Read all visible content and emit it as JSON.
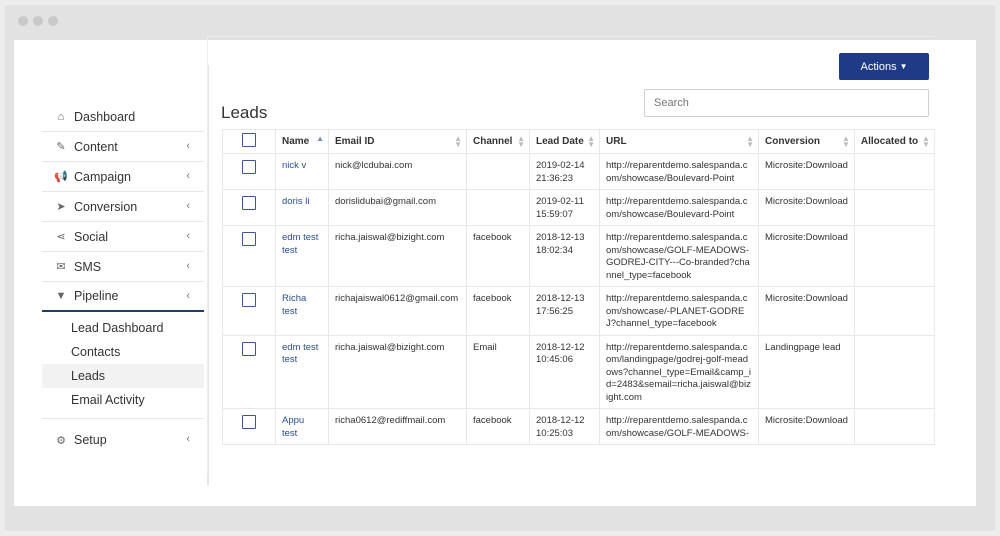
{
  "sidebar": {
    "items": [
      {
        "label": "Dashboard",
        "icon": "home-icon",
        "glyph": "⌂",
        "has_chevron": false
      },
      {
        "label": "Content",
        "icon": "edit-icon",
        "glyph": "✎",
        "has_chevron": true
      },
      {
        "label": "Campaign",
        "icon": "megaphone-icon",
        "glyph": "📢",
        "has_chevron": true
      },
      {
        "label": "Conversion",
        "icon": "cursor-icon",
        "glyph": "➤",
        "has_chevron": true
      },
      {
        "label": "Social",
        "icon": "share-icon",
        "glyph": "⋖",
        "has_chevron": true
      },
      {
        "label": "SMS",
        "icon": "envelope-icon",
        "glyph": "✉",
        "has_chevron": true
      },
      {
        "label": "Pipeline",
        "icon": "filter-icon",
        "glyph": "▼",
        "has_chevron": true
      }
    ],
    "pipeline_sub": [
      "Lead Dashboard",
      "Contacts",
      "Leads",
      "Email Activity"
    ],
    "setup": {
      "label": "Setup",
      "icon": "gear-icon",
      "glyph": "⚙"
    },
    "chevron": "‹"
  },
  "page": {
    "title": "Leads",
    "actions_label": "Actions",
    "search_placeholder": "Search"
  },
  "table": {
    "columns": [
      "Name",
      "Email ID",
      "Channel",
      "Lead Date",
      "URL",
      "Conversion",
      "Allocated to"
    ],
    "rows": [
      {
        "name": "nick v",
        "email": "nick@lcdubai.com",
        "channel": "",
        "date": "2019-02-14 21:36:23",
        "url": "http://reparentdemo.salespanda.com/showcase/Boulevard-Point",
        "conversion": "Microsite:Download",
        "allocated": ""
      },
      {
        "name": "doris li",
        "email": "dorislidubai@gmail.com",
        "channel": "",
        "date": "2019-02-11 15:59:07",
        "url": "http://reparentdemo.salespanda.com/showcase/Boulevard-Point",
        "conversion": "Microsite:Download",
        "allocated": ""
      },
      {
        "name": "edm test test",
        "email": "richa.jaiswal@bizight.com",
        "channel": "facebook",
        "date": "2018-12-13 18:02:34",
        "url": "http://reparentdemo.salespanda.com/showcase/GOLF-MEADOWS-GODREJ-CITY---Co-branded?channel_type=facebook",
        "conversion": "Microsite:Download",
        "allocated": ""
      },
      {
        "name": "Richa test",
        "email": "richajaiswal0612@gmail.com",
        "channel": "facebook",
        "date": "2018-12-13 17:56:25",
        "url": "http://reparentdemo.salespanda.com/showcase/-PLANET-GODREJ?channel_type=facebook",
        "conversion": "Microsite:Download",
        "allocated": ""
      },
      {
        "name": "edm test test",
        "email": "richa.jaiswal@bizight.com",
        "channel": "Email",
        "date": "2018-12-12 10:45:06",
        "url": "http://reparentdemo.salespanda.com/landingpage/godrej-golf-meadows?channel_type=Email&camp_id=2483&semail=richa.jaiswal@bizight.com",
        "conversion": "Landingpage lead",
        "allocated": ""
      },
      {
        "name": "Appu test",
        "email": "richa0612@rediffmail.com",
        "channel": "facebook",
        "date": "2018-12-12 10:25:03",
        "url": "http://reparentdemo.salespanda.com/showcase/GOLF-MEADOWS-",
        "conversion": "Microsite:Download",
        "allocated": ""
      }
    ]
  }
}
